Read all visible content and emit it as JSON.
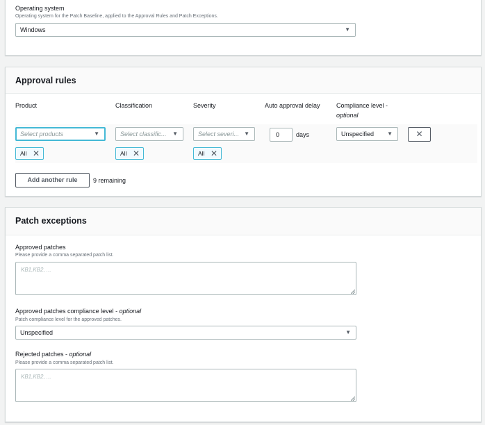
{
  "os_section": {
    "label": "Operating system",
    "description": "Operating system for the Patch Baseline, applied to the Approval Rules and Patch Exceptions.",
    "selected": "Windows"
  },
  "approval_rules": {
    "title": "Approval rules",
    "columns": {
      "product": "Product",
      "classification": "Classification",
      "severity": "Severity",
      "delay": "Auto approval delay",
      "compliance": "Compliance level -",
      "compliance_optional": "optional"
    },
    "rule": {
      "product_placeholder": "Select products",
      "classification_placeholder": "Select classific...",
      "severity_placeholder": "Select severi...",
      "delay_value": "0",
      "delay_unit": "days",
      "compliance_value": "Unspecified",
      "product_token": "All",
      "classification_token": "All",
      "severity_token": "All"
    },
    "add_button": "Add another rule",
    "remaining": "9 remaining"
  },
  "patch_exceptions": {
    "title": "Patch exceptions",
    "approved": {
      "label": "Approved patches",
      "description": "Please provide a comma separated patch list.",
      "placeholder": "KB1,KB2, ..."
    },
    "approved_compliance": {
      "label": "Approved patches compliance level - ",
      "optional": "optional",
      "description": "Patch compliance level for the approved patches.",
      "selected": "Unspecified"
    },
    "rejected": {
      "label": "Rejected patches - ",
      "optional": "optional",
      "description": "Please provide a comma separated patch list.",
      "placeholder": "KB1,KB2, ..."
    }
  },
  "icons": {
    "caret": "▼",
    "close": "✕"
  }
}
